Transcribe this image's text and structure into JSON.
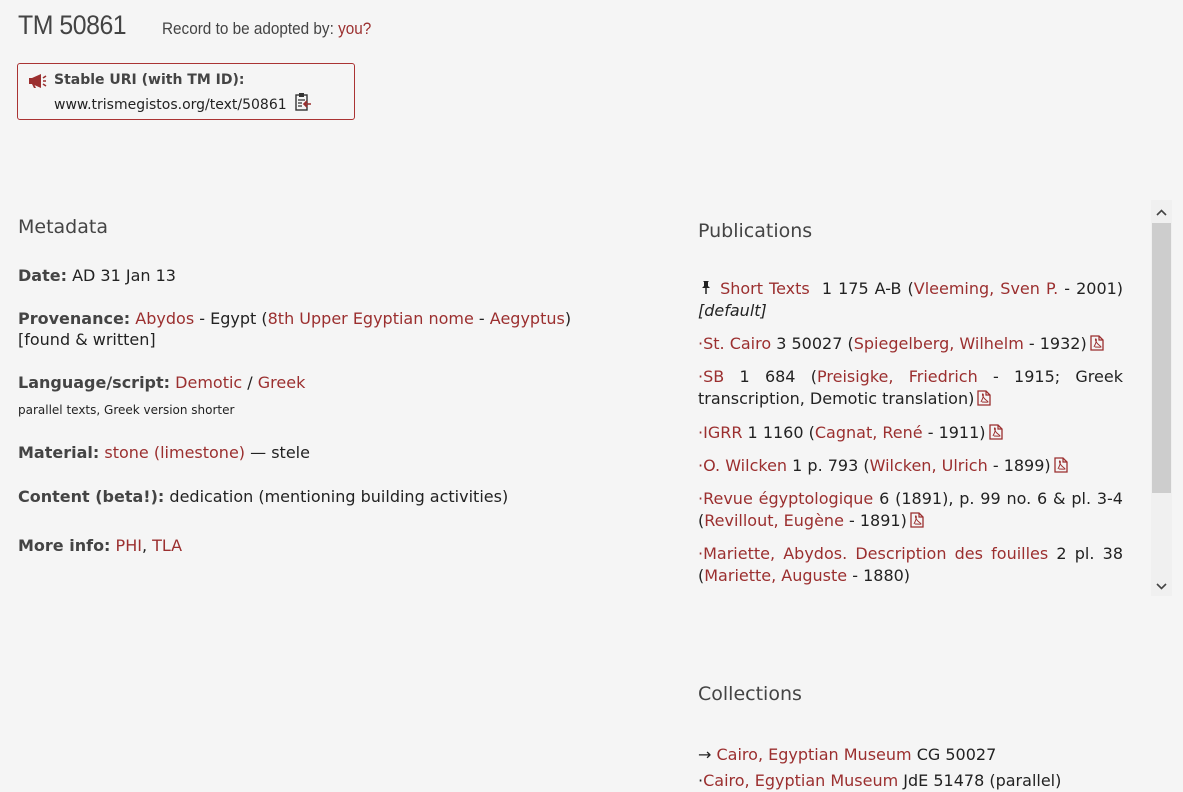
{
  "header": {
    "tm_title": "TM 50861",
    "adopt_prefix": "Record to be adopted by: ",
    "adopt_link": "you?"
  },
  "stable_uri": {
    "label": "Stable URI (with TM ID):",
    "value": "www.trismegistos.org/text/50861"
  },
  "metadata": {
    "heading": "Metadata",
    "date_label": "Date:",
    "date_value": "AD 31 Jan 13",
    "provenance_label": "Provenance:",
    "provenance_place": "Abydos",
    "provenance_country": "Egypt",
    "provenance_nome": "8th Upper Egyptian nome",
    "provenance_region": "Aegyptus",
    "provenance_note": "[found & written]",
    "language_label": "Language/script:",
    "language_1": "Demotic",
    "language_2": "Greek",
    "language_note": "parallel texts, Greek version shorter",
    "material_label": "Material:",
    "material_link": "stone (limestone)",
    "material_rest": "— stele",
    "content_label": "Content (beta!):",
    "content_value": "dedication (mentioning building activities)",
    "more_label": "More info:",
    "more_1": "PHI",
    "more_2": "TLA"
  },
  "publications": {
    "heading": "Publications",
    "items": [
      {
        "title": "Short Texts",
        "ref": "1 175 A-B",
        "author": "Vleeming, Sven P.",
        "year": "- 2001)",
        "default": "[default]"
      },
      {
        "title": "St. Cairo",
        "ref": "3 50027",
        "author": "Spiegelberg, Wilhelm",
        "year": "- 1932)"
      },
      {
        "title": "SB",
        "ref": "1 684",
        "author": "Preisigke, Friedrich",
        "year": "- 1915; Greek transcription, Demotic translation)"
      },
      {
        "title": "IGRR",
        "ref": "1 1160",
        "author": "Cagnat, René",
        "year": "- 1911)"
      },
      {
        "title": "O. Wilcken",
        "ref": "1 p. 793",
        "author": "Wilcken, Ulrich",
        "year": "- 1899)"
      },
      {
        "title": "Revue égyptologique",
        "ref": "6 (1891), p. 99 no. 6 & pl. 3-4",
        "author": "Revillout, Eugène",
        "year": "- 1891)"
      },
      {
        "title": "Mariette, Abydos. Description des fouilles",
        "ref": "2 pl. 38",
        "author": "Mariette, Auguste",
        "year": "- 1880)"
      }
    ]
  },
  "collections": {
    "heading": "Collections",
    "items": [
      {
        "prefix": "→ ",
        "name": "Cairo, Egyptian Museum",
        "number": "CG 50027"
      },
      {
        "prefix": "·",
        "name": "Cairo, Egyptian Museum",
        "number": "JdE 51478 (parallel)"
      }
    ]
  },
  "icons": {
    "megaphone": "megaphone-icon",
    "clipboard": "clipboard-icon",
    "pin": "pin-icon",
    "pdf": "pdf-icon"
  },
  "colors": {
    "link": "#9b2f2f",
    "border": "#aa3333",
    "background": "#f5f5f5"
  }
}
